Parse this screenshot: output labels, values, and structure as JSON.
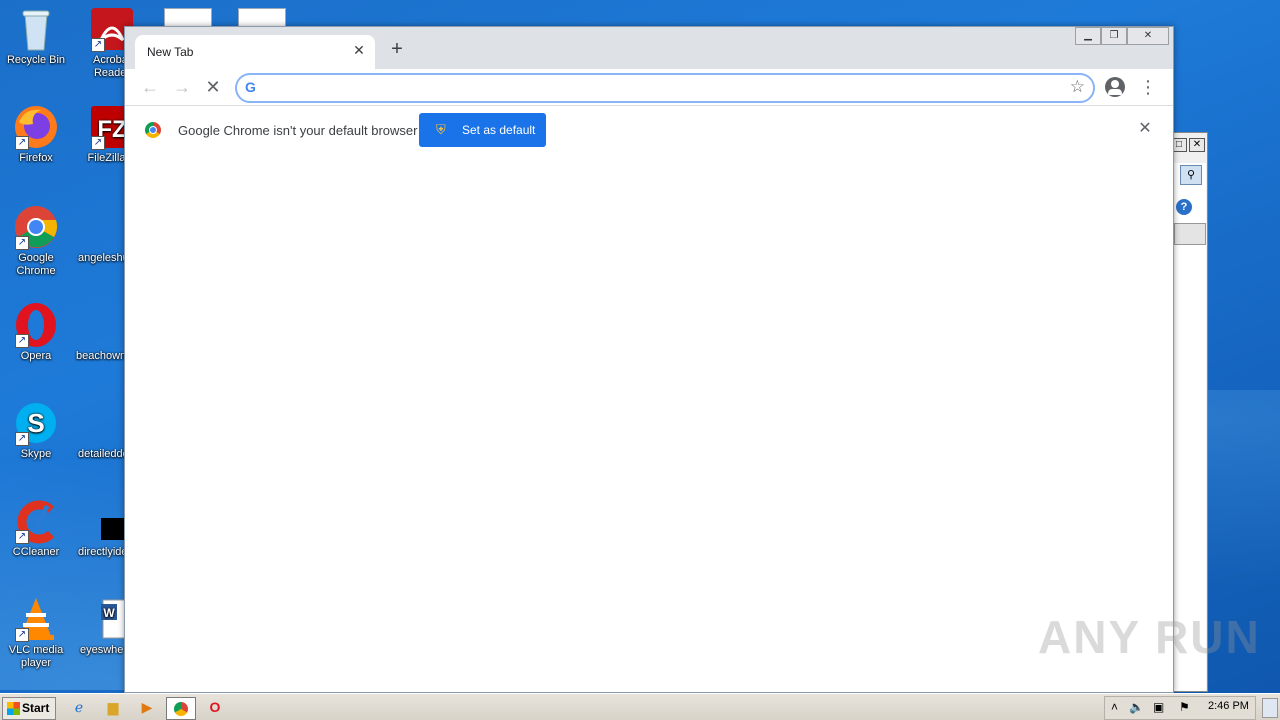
{
  "desktop": {
    "icons": [
      {
        "label": "Recycle Bin"
      },
      {
        "label": "Acrobat Reader"
      },
      {
        "label": "Firefox"
      },
      {
        "label": "FileZilla C"
      },
      {
        "label": "Google Chrome"
      },
      {
        "label": "angeleshu"
      },
      {
        "label": "Opera"
      },
      {
        "label": "beachown"
      },
      {
        "label": "Skype"
      },
      {
        "label": "detaileddc"
      },
      {
        "label": "CCleaner"
      },
      {
        "label": "directlyide"
      },
      {
        "label": "VLC media player"
      },
      {
        "label": "eyeswhe"
      }
    ]
  },
  "browser": {
    "tab_title": "New Tab",
    "omnibox_value": "",
    "infobar": {
      "message": "Google Chrome isn't your default browser",
      "button_label": "Set as default"
    }
  },
  "taskbar": {
    "start_label": "Start",
    "clock": "2:46 PM"
  },
  "watermark": "ANY RUN",
  "colors": {
    "accent": "#1a73e8",
    "desktop": "#1e7ad8"
  }
}
